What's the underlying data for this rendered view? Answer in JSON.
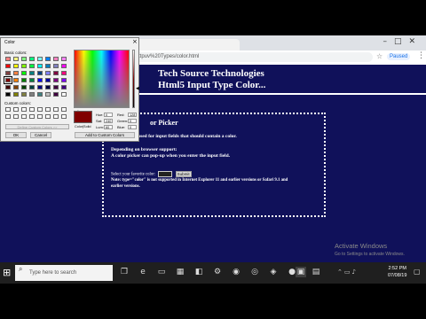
{
  "browser": {
    "omnibox": "ttpuv%20Types/color.html",
    "paused_label": "Paused",
    "menu_icon": "⋮"
  },
  "page": {
    "header_line1": "Tech Source Technologies",
    "header_line2": "Html5 Input Type Color...",
    "box_title": "or Picker",
    "line1": "e=\"color\" is used for input fields that should contain a color.",
    "dep_line1": "Depending on browser support:",
    "dep_line2": "A color picker can pop-up when you enter the input field.",
    "select_label": "Select your favorite color:",
    "submit_label": "Submit",
    "note_line1": "Note: type=\"color\" is not supported in Internet Explorer 11 and earlier versions or Safari 9.1 and",
    "note_line2": "earlier versions."
  },
  "color_dialog": {
    "title": "Color",
    "close_label": "×",
    "basic_colors_label": "Basic colors:",
    "custom_colors_label": "Custom colors:",
    "define_button_label": "Define Custom Colors >>",
    "ok_label": "OK",
    "cancel_label": "Cancel",
    "add_button_label": "Add to Custom Colors",
    "solid_label": "Color|Solid",
    "fields": {
      "hue_label": "Hue:",
      "hue": "0",
      "sat_label": "Sat:",
      "sat": "240",
      "lum_label": "Lum:",
      "lum": "60",
      "red_label": "Red:",
      "red": "128",
      "green_label": "Green:",
      "green": "0",
      "blue_label": "Blue:",
      "blue": "0"
    },
    "basic_colors": [
      "#ff8080",
      "#ffff80",
      "#80ff80",
      "#00ff80",
      "#80ffff",
      "#0080ff",
      "#ff80c0",
      "#ff80ff",
      "#ff0000",
      "#ffff00",
      "#80ff00",
      "#00ff40",
      "#00ffff",
      "#0080c0",
      "#8080c0",
      "#ff00ff",
      "#804040",
      "#ff8040",
      "#00ff00",
      "#008080",
      "#004080",
      "#8080ff",
      "#800040",
      "#ff0080",
      "#800000",
      "#ff8000",
      "#008000",
      "#008040",
      "#0000ff",
      "#0000a0",
      "#800080",
      "#8000ff",
      "#400000",
      "#804000",
      "#004000",
      "#004040",
      "#000080",
      "#000040",
      "#400040",
      "#400080",
      "#000000",
      "#808000",
      "#808040",
      "#808080",
      "#408080",
      "#c0c0c0",
      "#400040",
      "#ffffff"
    ],
    "selected_index": 24
  },
  "activate": {
    "title": "Activate Windows",
    "subtitle": "Go to Settings to activate Windows."
  },
  "taskbar": {
    "search_placeholder": "Type here to search",
    "time": "2:52 PM",
    "date": "07/08/19"
  }
}
